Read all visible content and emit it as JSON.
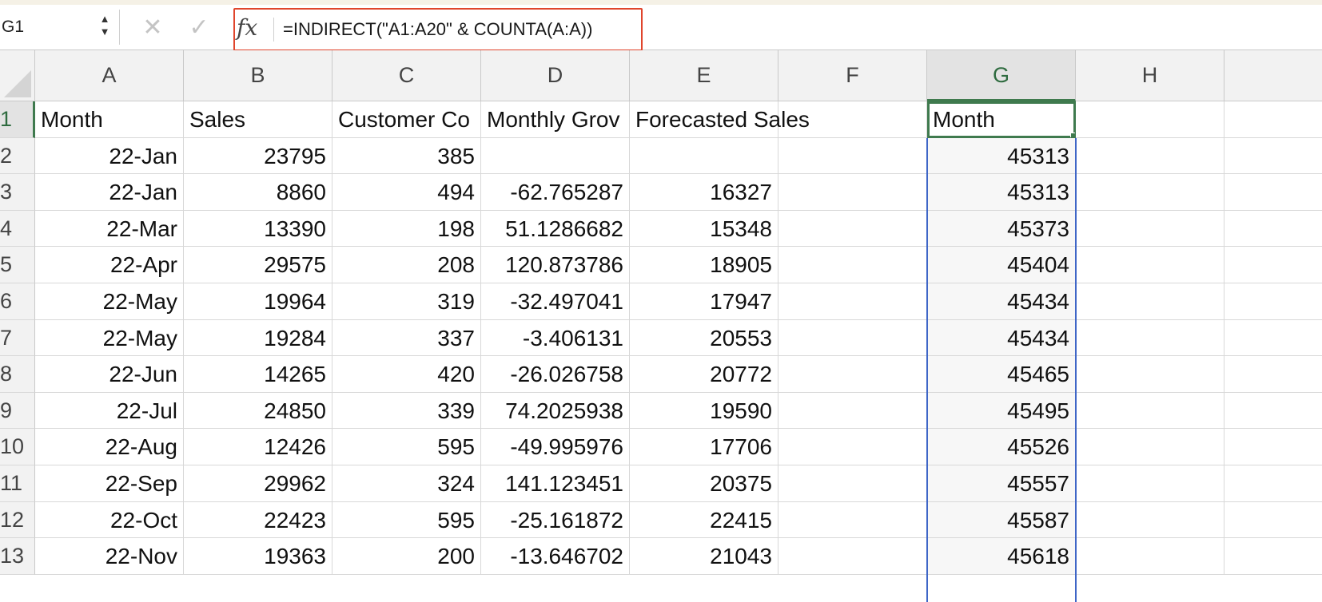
{
  "name_box": {
    "value": "G1",
    "stepper_up": "▲",
    "stepper_down": "▼"
  },
  "formula_bar": {
    "cancel_glyph": "✕",
    "confirm_glyph": "✓",
    "fx_label": "fx",
    "formula": "=INDIRECT(\"A1:A20\" & COUNTA(A:A))",
    "highlight_color": "#e0452c"
  },
  "grid": {
    "selected_cell": "G1",
    "selection_color": "#3f7a4e",
    "range_color": "#3f66c7",
    "columns": [
      "A",
      "B",
      "C",
      "D",
      "E",
      "F",
      "G",
      "H",
      ""
    ],
    "rows": [
      "1",
      "2",
      "3",
      "4",
      "5",
      "6",
      "7",
      "8",
      "9",
      "10",
      "11",
      "12",
      "13"
    ],
    "cells": [
      [
        "Month",
        "Sales",
        "Customer Co",
        "Monthly Grov",
        "Forecasted Sales",
        "",
        "Month",
        "",
        ""
      ],
      [
        "22-Jan",
        "23795",
        "385",
        "",
        "",
        "",
        "45313",
        "",
        ""
      ],
      [
        "22-Jan",
        "8860",
        "494",
        "-62.765287",
        "16327",
        "",
        "45313",
        "",
        ""
      ],
      [
        "22-Mar",
        "13390",
        "198",
        "51.1286682",
        "15348",
        "",
        "45373",
        "",
        ""
      ],
      [
        "22-Apr",
        "29575",
        "208",
        "120.873786",
        "18905",
        "",
        "45404",
        "",
        ""
      ],
      [
        "22-May",
        "19964",
        "319",
        "-32.497041",
        "17947",
        "",
        "45434",
        "",
        ""
      ],
      [
        "22-May",
        "19284",
        "337",
        "-3.406131",
        "20553",
        "",
        "45434",
        "",
        ""
      ],
      [
        "22-Jun",
        "14265",
        "420",
        "-26.026758",
        "20772",
        "",
        "45465",
        "",
        ""
      ],
      [
        "22-Jul",
        "24850",
        "339",
        "74.2025938",
        "19590",
        "",
        "45495",
        "",
        ""
      ],
      [
        "22-Aug",
        "12426",
        "595",
        "-49.995976",
        "17706",
        "",
        "45526",
        "",
        ""
      ],
      [
        "22-Sep",
        "29962",
        "324",
        "141.123451",
        "20375",
        "",
        "45557",
        "",
        ""
      ],
      [
        "22-Oct",
        "22423",
        "595",
        "-25.161872",
        "22415",
        "",
        "45587",
        "",
        ""
      ],
      [
        "22-Nov",
        "19363",
        "200",
        "-13.646702",
        "21043",
        "",
        "45618",
        "",
        ""
      ]
    ]
  }
}
